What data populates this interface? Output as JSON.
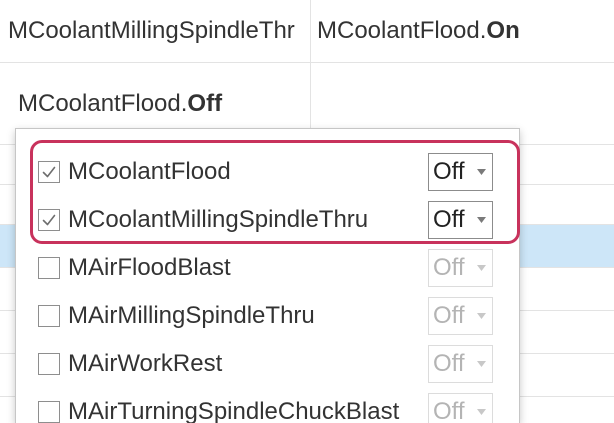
{
  "grid": {
    "rows": [
      {
        "col1": {
          "text": "MCoolantMillingSpindleThr"
        },
        "col2": {
          "text": "MCoolantFlood.",
          "bold": "On"
        }
      },
      {
        "col1": {
          "text": "MCoolantFlood.",
          "bold": "Off"
        }
      }
    ]
  },
  "popup": {
    "items": [
      {
        "label": "MCoolantFlood",
        "checked": true,
        "value": "Off",
        "enabled": true
      },
      {
        "label": "MCoolantMillingSpindleThru",
        "checked": true,
        "value": "Off",
        "enabled": true
      },
      {
        "label": "MAirFloodBlast",
        "checked": false,
        "value": "Off",
        "enabled": false
      },
      {
        "label": "MAirMillingSpindleThru",
        "checked": false,
        "value": "Off",
        "enabled": false
      },
      {
        "label": "MAirWorkRest",
        "checked": false,
        "value": "Off",
        "enabled": false
      },
      {
        "label": "MAirTurningSpindleChuckBlast",
        "checked": false,
        "value": "Off",
        "enabled": false
      }
    ]
  },
  "colors": {
    "text": "#333333",
    "grid_line": "#e3e3e3",
    "selected_row": "#cde6f8",
    "highlight_outline": "#c8325c",
    "disabled_text": "#b4b4b4",
    "check": "#6e6e6e"
  },
  "icons": {
    "checkbox_check": "checkmark-icon",
    "dropdown_arrow": "chevron-down-icon"
  }
}
